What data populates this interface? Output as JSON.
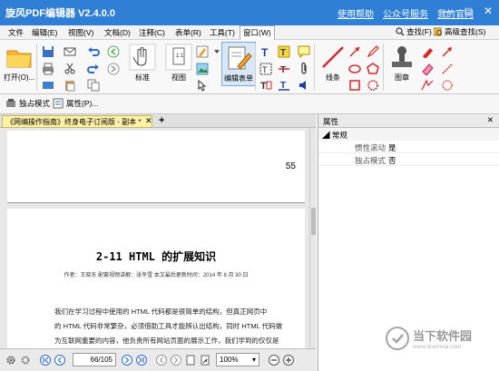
{
  "window": {
    "title": "旋风PDF编辑器 V2.4.0.0",
    "links": [
      "使用帮助",
      "公众号服务",
      "我的官网"
    ],
    "controls": [
      "—",
      "□",
      "✕"
    ]
  },
  "menu": {
    "items": [
      "文件",
      "编辑(E)",
      "视图(V)",
      "文档(D)",
      "注释(C)",
      "表单(R)",
      "工具(T)",
      "窗口(W)"
    ],
    "find": "查找(F)",
    "advanced_find": "高级查找(S)"
  },
  "ribbon": {
    "open": "打开(O)...",
    "standard": "标准",
    "view": "视图",
    "edit_form": "编辑表单",
    "line": "线条",
    "stamp": "图章"
  },
  "toolbar2": {
    "exclusive_mode": "独占模式",
    "properties": "属性(P)..."
  },
  "document": {
    "tab_title": "《网编操作指南》终身电子订阅版 - 副本 *",
    "page_number": "55",
    "chapter_title": "2-11 HTML 的扩展知识",
    "meta": "作者：王晓东  配套视频讲解：张冬雪  本文最后更新时间：2014 年 8 月 30 日",
    "paragraph": [
      "我们在学习过程中使用的 HTML 代码都是很简单的结构，但真正网页中",
      "的 HTML 代码非常繁杂，必须借助工具才能辨认出结构，同时 HTML 代码做",
      "为互联网重要的内容，他负责所有网站页面的展示工作，我们学到的仅仅是"
    ]
  },
  "status": {
    "page": "66/105",
    "zoom": "100%"
  },
  "properties": {
    "title": "属性",
    "group": "常规",
    "rows": [
      {
        "key": "惯性滚动",
        "value": "是"
      },
      {
        "key": "独占模式",
        "value": "否"
      }
    ]
  },
  "watermark": {
    "text": "当下软件园",
    "url": "www.downxia.com"
  },
  "colors": {
    "titlebar": "#2f7fd6",
    "doctab": "#fff2a8",
    "accent_red": "#d9262b"
  }
}
